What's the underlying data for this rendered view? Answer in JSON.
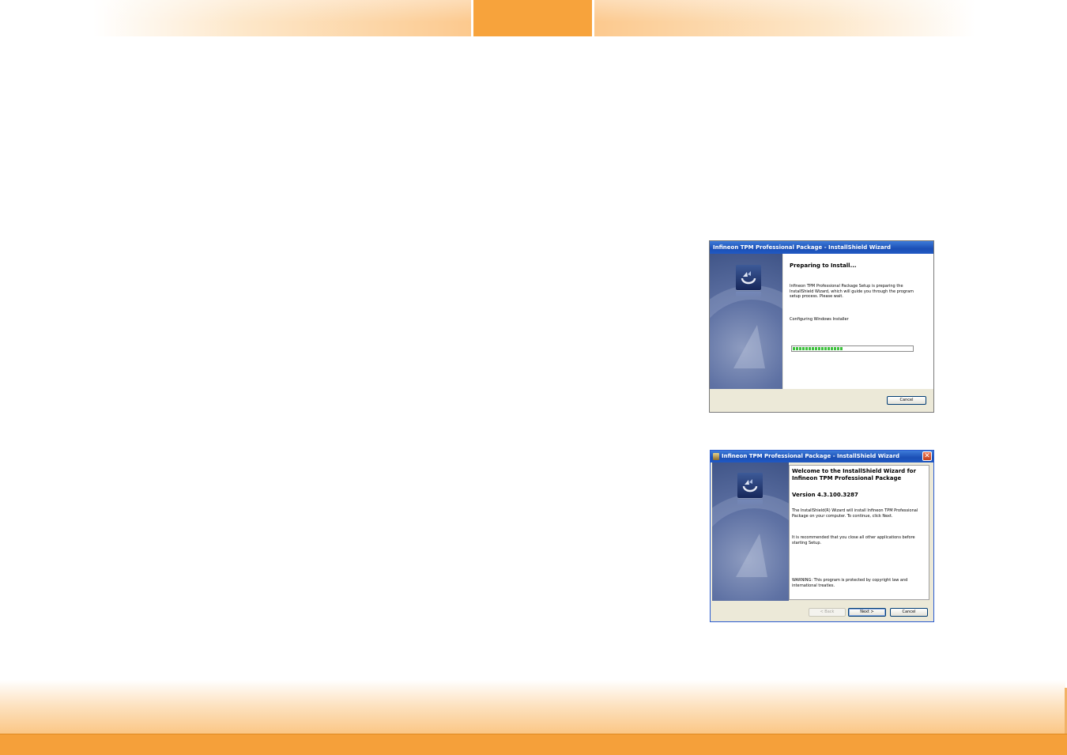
{
  "wizard_preparing": {
    "title": "Infineon TPM Professional Package - InstallShield Wizard",
    "heading": "Preparing to Install...",
    "body": "Infineon TPM Professional Package Setup is preparing the InstallShield Wizard, which will guide you through the program setup process.  Please wait.",
    "status": "Configuring Windows Installer",
    "progress_fraction": 0.42,
    "cancel_label": "Cancel"
  },
  "wizard_welcome": {
    "title": "Infineon TPM Professional Package - InstallShield Wizard",
    "heading_line1": "Welcome to the InstallShield Wizard for",
    "heading_line2": "Infineon TPM Professional Package",
    "version": "Version 4.3.100.3287",
    "body1": "The InstallShield(R) Wizard will install Infineon TPM Professional Package on your computer.  To continue, click Next.",
    "body2": "It is recommended that you close all other applications before starting Setup.",
    "warning": "WARNING: This program is protected by copyright law and international treaties.",
    "back_label": "< Back",
    "next_label": "Next >",
    "cancel_label": "Cancel",
    "close_glyph": "✕"
  }
}
